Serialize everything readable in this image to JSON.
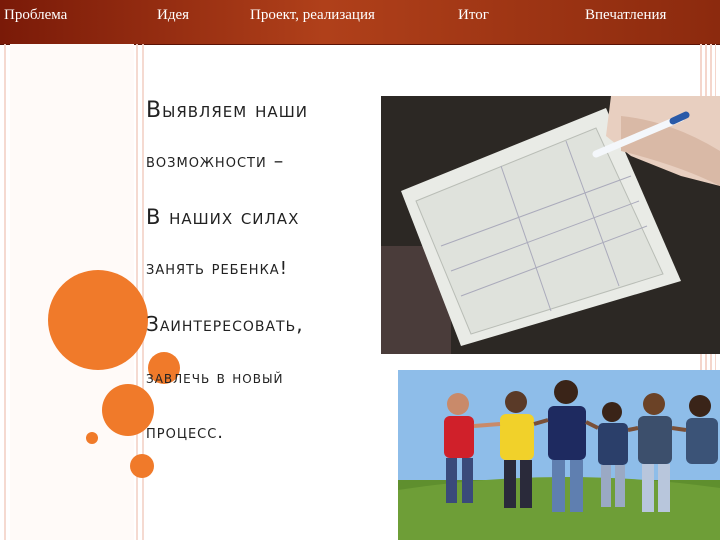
{
  "nav": {
    "items": [
      "Проблема",
      "Идея",
      "Проект, реализация",
      "Итог",
      "Впечатления"
    ]
  },
  "content": {
    "lines": [
      "Выявляем наши",
      "возможности –",
      "В наших силах",
      "занять ребенка!",
      "Заинтересовать,",
      "завлечь в новый",
      "процесс."
    ]
  },
  "colors": {
    "nav_bar": "#9a3414",
    "accent_circles": "#f07a2a",
    "stripes": "#f4d6cc"
  }
}
